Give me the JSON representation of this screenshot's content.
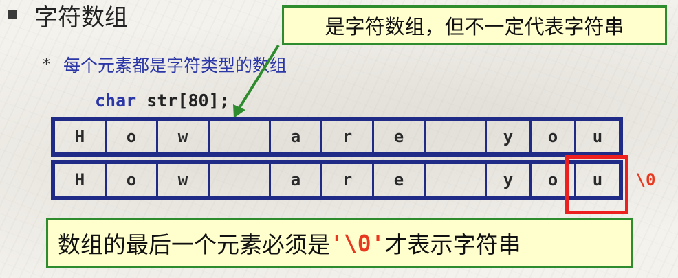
{
  "slide": {
    "title": "字符数组",
    "subtitle": "每个元素都是字符类型的数组",
    "star": "*",
    "code_keyword": "char",
    "code_rest": " str[80];"
  },
  "callout_top": {
    "text": "是字符数组，但不一定代表字符串"
  },
  "array_rows": [
    [
      "H",
      "o",
      "w",
      "",
      "a",
      "r",
      "e",
      "",
      "y",
      "o",
      "u",
      ""
    ],
    [
      "H",
      "o",
      "w",
      "",
      "a",
      "r",
      "e",
      "",
      "y",
      "o",
      "u",
      "\\0"
    ]
  ],
  "callout_bottom": {
    "before": "数组的最后一个元素必须是",
    "quoted": "'\\0'",
    "after": "才表示字符串"
  },
  "colors": {
    "callout_border": "#2e8b2e",
    "callout_fill": "#fffecd",
    "array_border": "#1f2b86",
    "highlight": "#ee1f1f",
    "keyword": "#2b37a6"
  }
}
